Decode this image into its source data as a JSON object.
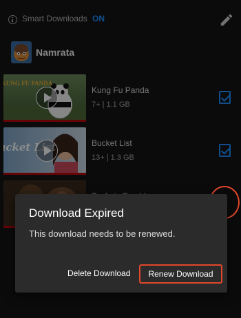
{
  "header": {
    "smart_downloads_label": "Smart Downloads",
    "smart_downloads_state": "ON"
  },
  "profile": {
    "name": "Namrata"
  },
  "downloads": [
    {
      "title": "Kung Fu Panda",
      "meta": "7+ | 1.1 GB",
      "thumb_text": "KUNG FU PANDA",
      "selected": true
    },
    {
      "title": "Bucket List",
      "meta": "13+ | 1.3 GB",
      "thumb_text": "Bucket List",
      "selected": true
    },
    {
      "title": "Teefa in Trouble",
      "meta": "",
      "thumb_text": "",
      "selected": false,
      "expired": true
    }
  ],
  "dialog": {
    "title": "Download Expired",
    "message": "This download needs to be renewed.",
    "delete_label": "Delete Download",
    "renew_label": "Renew Download"
  },
  "colors": {
    "background": "#141414",
    "accent_blue": "#1e90ff",
    "netflix_red": "#b9090b",
    "highlight_annotation": "#e2482b",
    "dialog_bg": "#2b2b2b"
  },
  "icons": {
    "info": "info-icon",
    "edit": "pencil-icon",
    "play": "play-icon",
    "checkbox": "checkbox-checked-icon",
    "download_status": "download-status-icon"
  }
}
